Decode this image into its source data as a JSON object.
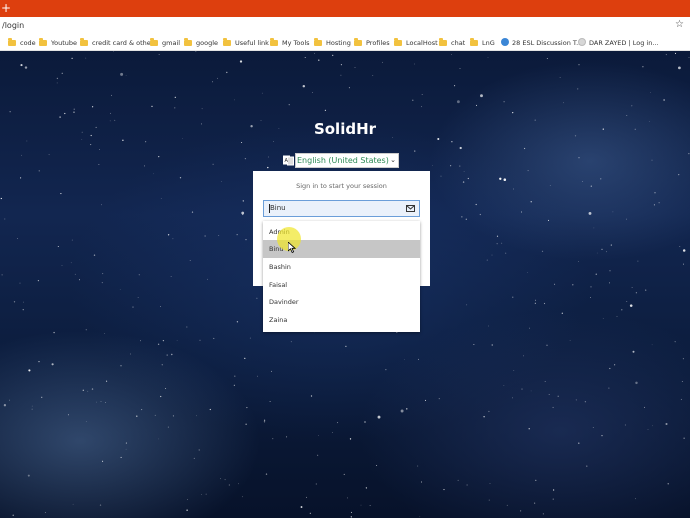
{
  "browser": {
    "tab_plus": "+",
    "url": "/login",
    "star": "☆",
    "bookmarks": [
      {
        "label": "code",
        "icon": "folder-icon"
      },
      {
        "label": "Youtube",
        "icon": "folder-icon"
      },
      {
        "label": "credit card & other",
        "icon": "folder-icon"
      },
      {
        "label": "gmail",
        "icon": "folder-icon"
      },
      {
        "label": "google",
        "icon": "folder-icon"
      },
      {
        "label": "Useful link",
        "icon": "folder-icon"
      },
      {
        "label": "My Tools",
        "icon": "folder-icon"
      },
      {
        "label": "Hosting",
        "icon": "folder-icon"
      },
      {
        "label": "Profiles",
        "icon": "folder-icon"
      },
      {
        "label": "LocalHost",
        "icon": "folder-icon"
      },
      {
        "label": "chat",
        "icon": "folder-icon"
      },
      {
        "label": "LnG",
        "icon": "folder-icon"
      },
      {
        "label": "28 ESL Discussion T...",
        "icon": "globe-icon"
      },
      {
        "label": "DAR ZAYED | Log in...",
        "icon": "site-icon"
      }
    ]
  },
  "app": {
    "title": "SolidHr",
    "language": "English (United States)",
    "login_message": "Sign in to start your session",
    "username_value": "Binu",
    "suggestions": [
      "Admin",
      "Binu",
      "Bashin",
      "Faisal",
      "Davinder",
      "Zaina"
    ],
    "selected_suggestion": "Binu"
  },
  "colors": {
    "tabstrip": "#dd3f0e",
    "language_text": "#2e8b57",
    "input_border": "#6b9ed9",
    "selected_row": "#c6c6c6",
    "cursor_highlight": "#f0e628"
  }
}
